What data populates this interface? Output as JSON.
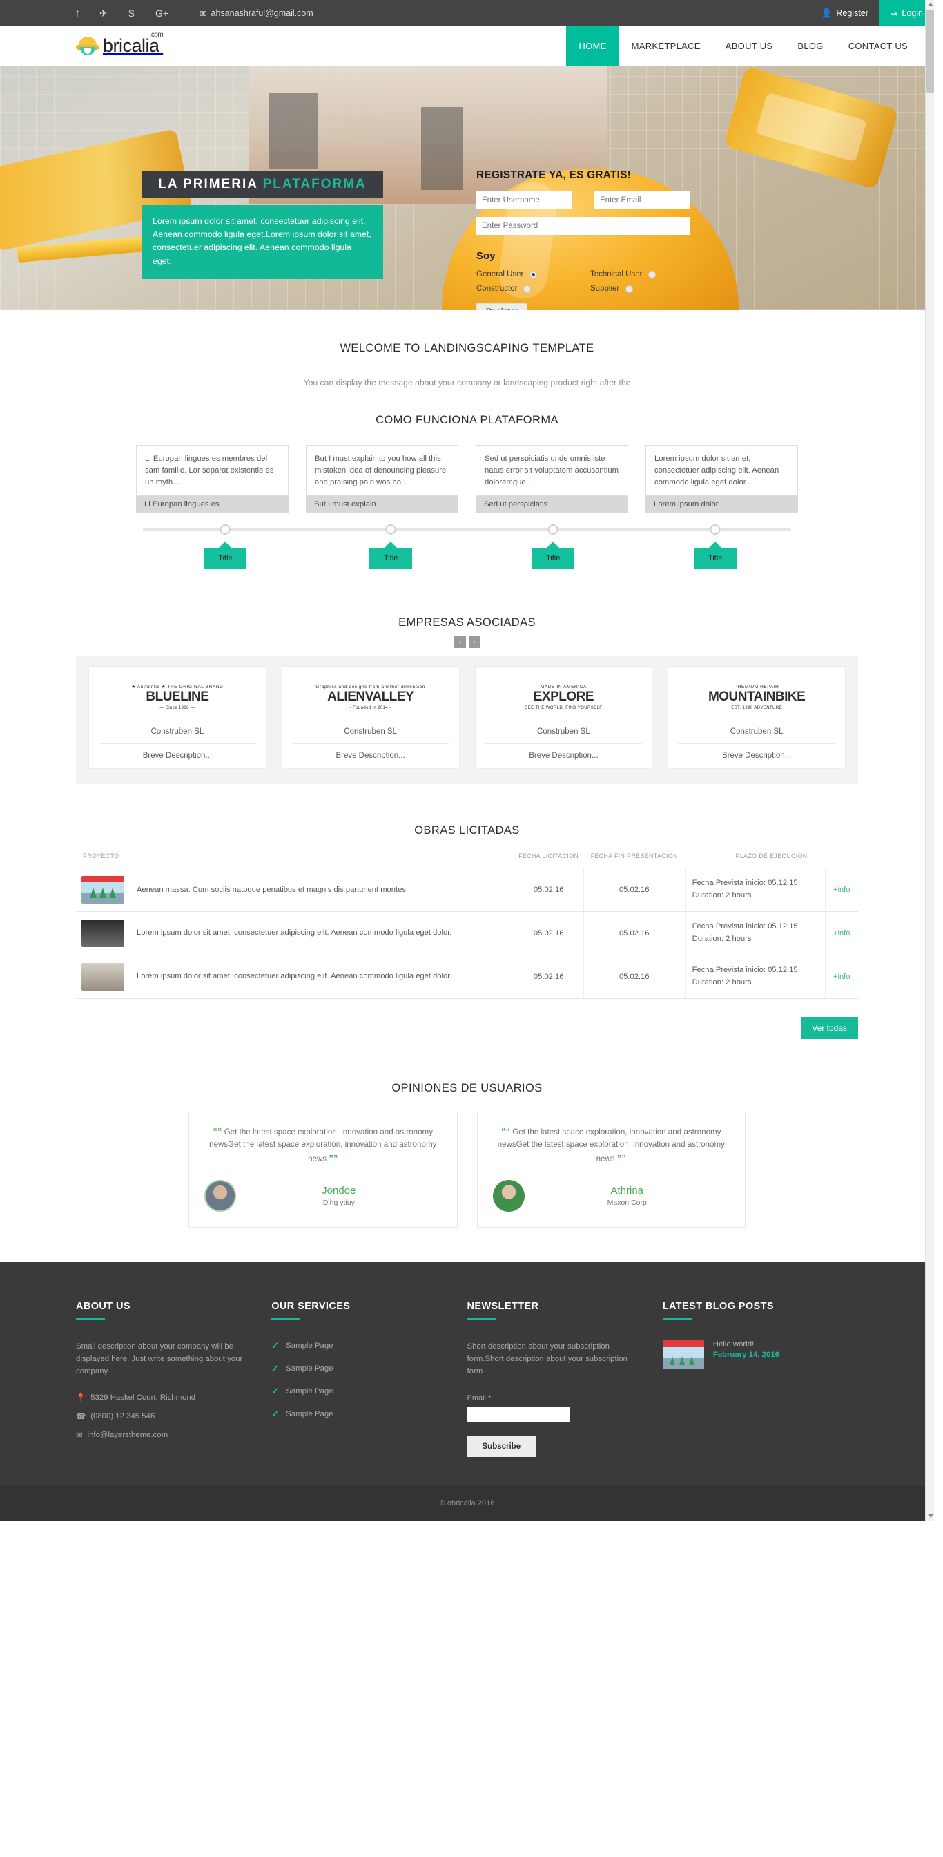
{
  "topbar": {
    "social": [
      {
        "name": "facebook-icon",
        "glyph": "f"
      },
      {
        "name": "twitter-icon",
        "glyph": "✈"
      },
      {
        "name": "skype-icon",
        "glyph": "S"
      },
      {
        "name": "google-plus-icon",
        "glyph": "G+"
      }
    ],
    "email": "ahsanashraful@gmail.com",
    "email_icon": "envelope-icon",
    "register_label": "Register",
    "login_label": "Login",
    "accent": "#00bd9c"
  },
  "brand": {
    "name": "bricalia",
    "tld": ".com",
    "icon": "hard-hat-icon"
  },
  "nav": {
    "items": [
      {
        "label": "HOME",
        "active": true
      },
      {
        "label": "MARKETPLACE",
        "active": false
      },
      {
        "label": "ABOUT US",
        "active": false
      },
      {
        "label": "BLOG",
        "active": false
      },
      {
        "label": "CONTACT US",
        "active": false
      }
    ]
  },
  "hero": {
    "ribbon_text_1": "LA PRIMERIA",
    "ribbon_text_2": "PLATAFORMA",
    "box_text": "Lorem ipsum dolor sit amet, consectetuer adipiscing elit. Aenean commodo ligula eget.Lorem ipsum dolor sit amet, consectetuer adipiscing elit. Aenean commodo ligula eget.",
    "form": {
      "title": "REGISTRATE YA, ES GRATIS!",
      "username_placeholder": "Enter Username",
      "email_placeholder": "Enter Email",
      "password_placeholder": "Enter Password",
      "soy_label": "Soy_",
      "options": [
        {
          "label": "General User",
          "checked": true
        },
        {
          "label": "Technical User",
          "checked": false
        },
        {
          "label": "Constructor",
          "checked": false
        },
        {
          "label": "Supplier",
          "checked": false
        }
      ],
      "submit_label": "Register"
    }
  },
  "welcome": {
    "title": "WELCOME TO LANDINGSCAPING TEMPLATE",
    "subtitle": "You can display the message about your company or landscaping product right after the"
  },
  "how": {
    "title": "COMO FUNCIONA PLATAFORMA",
    "cards": [
      {
        "body": "Li Europan lingues es membres del sam familie. Lor separat existentie es un myth....",
        "foot": "Li Europan lingues es",
        "tag": "Title"
      },
      {
        "body": "But I must explain to you how all this mistaken idea of denouncing pleasure and praising pain was bo...",
        "foot": "But I must explain",
        "tag": "Title"
      },
      {
        "body": "Sed ut perspiciatis unde omnis iste natus error sit voluptatem accusantium doloremque...",
        "foot": "Sed ut perspiciatis",
        "tag": "Title"
      },
      {
        "body": "Lorem ipsum dolor sit amet, consectetuer adipiscing elit. Aenean commodo ligula eget dolor...",
        "foot": "Lorem ipsum dolor",
        "tag": "Title"
      }
    ]
  },
  "partners": {
    "title": "EMPRESAS ASOCIADAS",
    "prev_label": "‹",
    "next_label": "›",
    "items": [
      {
        "logo_top": "★ Authentic ★ THE ORIGINAL BRAND",
        "logo_main": "BLUELINE",
        "logo_bot": "— Since 1988 —",
        "name": "Construben SL",
        "desc": "Breve Description..."
      },
      {
        "logo_top": "Graphics and designs from another dimension",
        "logo_main": "ALIENVALLEY",
        "logo_bot": "- Founded in 2014 -",
        "name": "Construben SL",
        "desc": "Breve Description..."
      },
      {
        "logo_top": "MADE IN AMERICA",
        "logo_main": "EXPLORE",
        "logo_bot": "SEE THE WORLD, FIND YOURSELF",
        "name": "Construben SL",
        "desc": "Breve Description..."
      },
      {
        "logo_top": "PREMIUM REPAIR",
        "logo_main": "MOUNTAINBIKE",
        "logo_bot": "EST. 1990 ADVENTURE",
        "name": "Construben SL",
        "desc": "Breve Description..."
      }
    ]
  },
  "obras": {
    "title": "OBRAS LICITADAS",
    "columns": [
      "PROYECTO",
      "FECHA LICITACION",
      "FECHA FIN PRESENTACION",
      "PLAZO DE EJECUCION"
    ],
    "rows": [
      {
        "desc": "Aenean massa. Cum sociis natoque penatibus et magnis dis parturient montes.",
        "fecha_licitacion": "05.02.16",
        "fecha_fin": "05.02.16",
        "plazo_line1": "Fecha Prevista inicio: 05.12.15",
        "plazo_line2": "Duration: 2 hours",
        "info": "+info"
      },
      {
        "desc": "Lorem ipsum dolor sit amet, consectetuer adipiscing elit. Aenean commodo ligula eget dolor.",
        "fecha_licitacion": "05.02.16",
        "fecha_fin": "05.02.16",
        "plazo_line1": "Fecha Prevista inicio: 05.12.15",
        "plazo_line2": "Duration: 2 hours",
        "info": "+info"
      },
      {
        "desc": "Lorem ipsum dolor sit amet, consectetuer adipiscing elit. Aenean commodo ligula eget dolor.",
        "fecha_licitacion": "05.02.16",
        "fecha_fin": "05.02.16",
        "plazo_line1": "Fecha Prevista inicio: 05.12.15",
        "plazo_line2": "Duration: 2 hours",
        "info": "+info"
      }
    ],
    "ver_todas_label": "Ver todas"
  },
  "testimonials": {
    "title": "OPINIONES DE USUARIOS",
    "items": [
      {
        "quote": "Get the latest space exploration, innovation and astronomy newsGet the latest space exploration, innovation and astronomy news",
        "name": "Jondoe",
        "role": "Djhg ytiuy"
      },
      {
        "quote": "Get the latest space exploration, innovation and astronomy newsGet the latest space exploration, innovation and astronomy news",
        "name": "Athrina",
        "role": "Maxon Corp"
      }
    ]
  },
  "footer": {
    "about": {
      "title": "ABOUT US",
      "text": "Small description about your company will be displayed here. Just write something about your company.",
      "address": "5329 Haskel Court, Richmond",
      "phone": "(0800) 12 345 546",
      "email": "info@layerstheme.com"
    },
    "services": {
      "title": "OUR SERVICES",
      "items": [
        "Sample Page",
        "Sample Page",
        "Sample Page",
        "Sample Page"
      ]
    },
    "newsletter": {
      "title": "NEWSLETTER",
      "text": "Short description about your subscription form.Short description about your subscription form.",
      "email_label": "Email *",
      "email_value": "",
      "subscribe_label": "Subscribe"
    },
    "blog": {
      "title": "LATEST BLOG POSTS",
      "post_title": "Hello world!",
      "post_date": "February 14, 2016"
    },
    "copyright": "© obricalia 2016"
  }
}
